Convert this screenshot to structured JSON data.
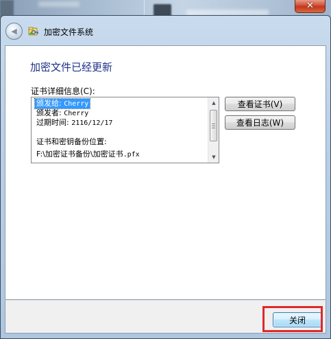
{
  "window": {
    "title": "加密文件系统",
    "close_glyph": "✕",
    "back_glyph": "◀"
  },
  "dialog": {
    "heading": "加密文件已经更新",
    "details_label": "证书详细信息(C):",
    "details_lines": [
      {
        "prefix": "颁发给: ",
        "value": "Cherry"
      },
      {
        "prefix": "颁发者: ",
        "value": "Cherry"
      },
      {
        "prefix": "过期时间: ",
        "value": "2116/12/17"
      },
      {
        "prefix": "",
        "value": ""
      },
      {
        "prefix": "证书和密钥备份位置:",
        "value": ""
      },
      {
        "prefix": "F:\\加密证书备份\\加密证书",
        "value": ".pfx"
      }
    ],
    "view_cert_label": "查看证书(V)",
    "view_log_label": "查看日志(W)"
  },
  "footer": {
    "close_label": "关闭"
  },
  "scrollbar": {
    "up_glyph": "▲",
    "down_glyph": "▼"
  },
  "colors": {
    "heading": "#1e3287",
    "selection": "#3399ff",
    "highlight_box": "#e0282a"
  }
}
